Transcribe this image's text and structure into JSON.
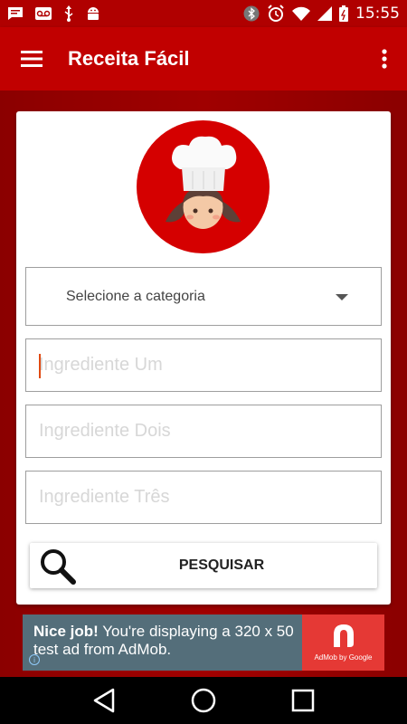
{
  "status_bar": {
    "time": "15:55",
    "left_icons": [
      "message-icon",
      "voicemail-icon",
      "usb-icon",
      "android-debug-icon"
    ],
    "right_icons": [
      "bluetooth-icon",
      "alarm-icon",
      "wifi-icon",
      "signal-icon",
      "battery-icon"
    ]
  },
  "app_bar": {
    "title": "Receita Fácil",
    "menu_icon": "hamburger-menu-icon",
    "overflow_icon": "more-vert-icon",
    "background": "#c10000"
  },
  "form": {
    "category_select": {
      "selected": "Selecione a categoria"
    },
    "ingredient_1": {
      "value": "",
      "placeholder": "Ingrediente Um"
    },
    "ingredient_2": {
      "value": "",
      "placeholder": "Ingrediente Dois"
    },
    "ingredient_3": {
      "value": "",
      "placeholder": "Ingrediente Três"
    },
    "search_button": {
      "label": "PESQUISAR",
      "icon": "search-icon"
    }
  },
  "ad_banner": {
    "headline": "Nice job!",
    "body": " You're displaying a 320 x 50 test ad from AdMob.",
    "brand": "AdMob by Google",
    "info_icon": "info-icon"
  },
  "nav_bar": {
    "buttons": [
      "back-icon",
      "home-icon",
      "recents-icon"
    ]
  },
  "colors": {
    "primary": "#c10000",
    "background": "#8e0000",
    "accent": "#e04a12",
    "ad_background": "#546e7a",
    "ad_logo": "#e53935"
  }
}
